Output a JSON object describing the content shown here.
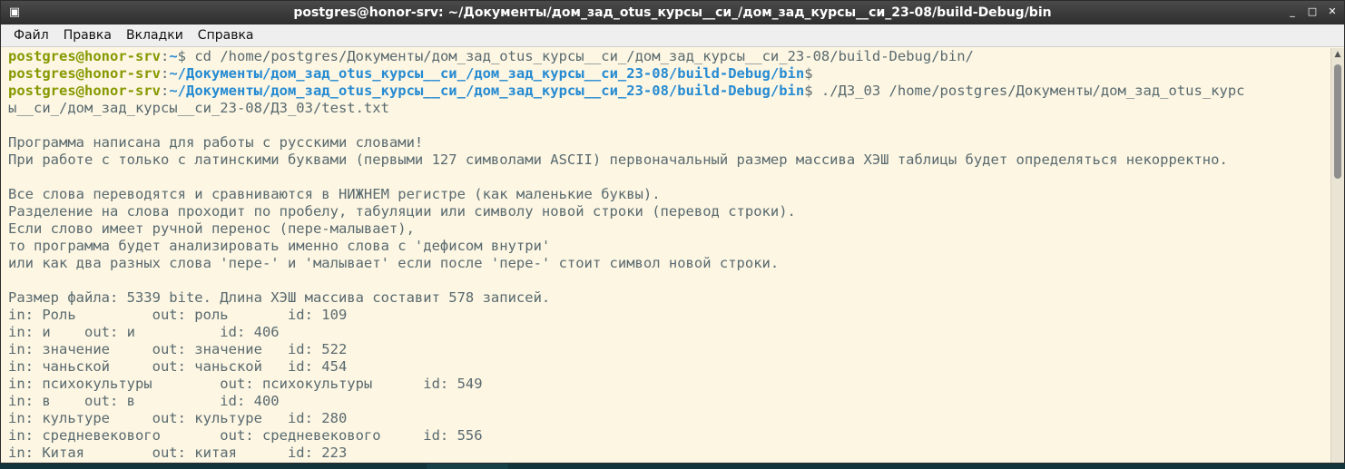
{
  "window": {
    "title": "postgres@honor-srv: ~/Документы/дом_зад_otus_курсы__си_/дом_зад_курсы__си_23-08/build-Debug/bin",
    "icon": "terminal-icon",
    "controls": [
      "_",
      "□",
      "✕"
    ]
  },
  "menu": {
    "items": [
      "Файл",
      "Правка",
      "Вкладки",
      "Справка"
    ]
  },
  "terminal": {
    "colors": {
      "background": "#fdf6e3",
      "text": "#596a6f",
      "user": "#859900",
      "path": "#268bd2"
    },
    "prompt": {
      "user": "postgres@honor-srv",
      "colon": ":"
    },
    "cmd1": {
      "path": "~",
      "dollar": "$",
      "command": " cd /home/postgres/Документы/дом_зад_otus_курсы__си_/дом_зад_курсы__си_23-08/build-Debug/bin/"
    },
    "cmd2": {
      "path": "~/Документы/дом_зад_otus_курсы__си_/дом_зад_курсы__си_23-08/build-Debug/bin",
      "dollar": "$",
      "command": ""
    },
    "cmd3": {
      "path": "~/Документы/дом_зад_otus_курсы__си_/дом_зад_курсы__си_23-08/build-Debug/bin",
      "dollar": "$",
      "command": " ./ДЗ_03 /home/postgres/Документы/дом_зад_otus_курс"
    },
    "output": [
      "ы__си_/дом_зад_курсы__си_23-08/ДЗ_03/test.txt",
      "",
      "Программа написана для работы с русскими словами!",
      "При работе с только с латинскими буквами (первыми 127 символами ASCII) первоначальный размер массива ХЭШ таблицы будет определяться некорректно.",
      "",
      "Все слова переводятся и сравниваются в НИЖНЕМ регистре (как маленькие буквы).",
      "Разделение на слова проходит по пробелу, табуляции или символу новой строки (перевод строки).",
      "Если слово имеет ручной перенос (пере-малывает),",
      "то программа будет анализировать именно слова с 'дефисом внутри'",
      "или как два разных слова 'пере-' и 'малывает' если после 'пере-' стоит символ новой строки.",
      "",
      "Размер файла: 5339 bite. Длина ХЭШ массива составит 578 записей.",
      "in: Роль         out: роль       id: 109",
      "in: и    out: и          id: 406",
      "in: значение     out: значение   id: 522",
      "in: чаньской     out: чаньской   id: 454",
      "in: психокультуры        out: психокультуры      id: 549",
      "in: в    out: в          id: 400",
      "in: культуре     out: культуре   id: 280",
      "in: средневекового       out: средневекового     id: 556",
      "in: Китая        out: китая      id: 223"
    ]
  }
}
